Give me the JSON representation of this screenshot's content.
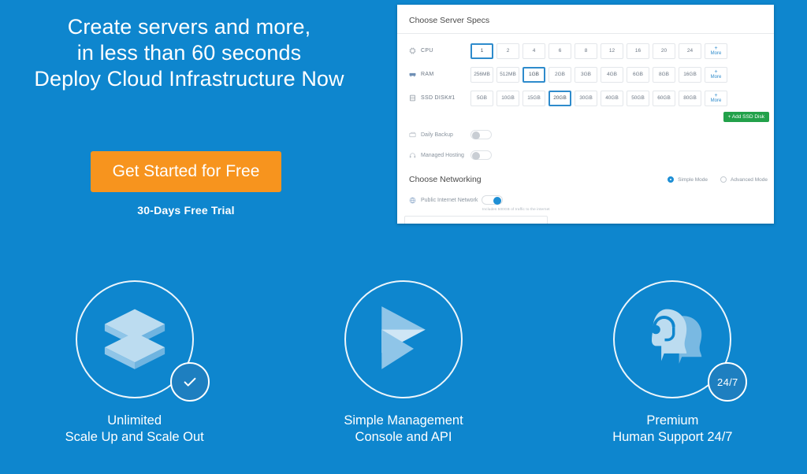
{
  "theme": {
    "background_blue": "#0e86ce",
    "cta_orange": "#f7941e",
    "accent_blue": "#2e8bcc",
    "green": "#22a14a",
    "panel_white": "#ffffff"
  },
  "hero": {
    "headline_line1": "Create servers and more,",
    "headline_line2": "in less than 60 seconds",
    "headline_line3": "Deploy Cloud Infrastructure Now",
    "cta_label": "Get Started for Free",
    "trial_note": "30-Days Free Trial"
  },
  "panel": {
    "title": "Choose Server Specs",
    "add_disk_label": "+ Add SSD Disk",
    "more_plus": "+",
    "more_label": "More",
    "specs": [
      {
        "label": "CPU",
        "icon": "cpu-icon",
        "selected": "1",
        "options": [
          "1",
          "2",
          "4",
          "6",
          "8",
          "12",
          "16",
          "20",
          "24"
        ]
      },
      {
        "label": "RAM",
        "icon": "ram-icon",
        "selected": "1GB",
        "options": [
          "256MB",
          "512MB",
          "1GB",
          "2GB",
          "3GB",
          "4GB",
          "6GB",
          "8GB",
          "16GB"
        ]
      },
      {
        "label": "SSD DISK#1",
        "icon": "disk-icon",
        "selected": "20GB",
        "options": [
          "5GB",
          "10GB",
          "15GB",
          "20GB",
          "30GB",
          "40GB",
          "50GB",
          "60GB",
          "80GB"
        ]
      }
    ],
    "toggles": [
      {
        "label": "Daily Backup",
        "icon": "backup-icon",
        "on": false
      },
      {
        "label": "Managed Hosting",
        "icon": "headset-icon",
        "on": false
      }
    ],
    "networking": {
      "title": "Choose Networking",
      "modes": [
        {
          "label": "Simple Mode",
          "selected": true
        },
        {
          "label": "Advanced Mode",
          "selected": false
        }
      ],
      "row": {
        "label": "Public Internet Network",
        "icon": "network-icon",
        "on": true,
        "helper": "Includes 500GB of traffic to the internet"
      }
    }
  },
  "features": [
    {
      "icon": "stacked-layers-icon",
      "badge": "check-icon",
      "title": "Unlimited",
      "subtitle": "Scale Up and Scale Out"
    },
    {
      "icon": "play-arrow-icon",
      "badge": "",
      "title": "Simple Management",
      "subtitle": "Console and API"
    },
    {
      "icon": "support-heads-icon",
      "badge": "24/7",
      "title": "Premium",
      "subtitle": "Human Support 24/7"
    }
  ]
}
